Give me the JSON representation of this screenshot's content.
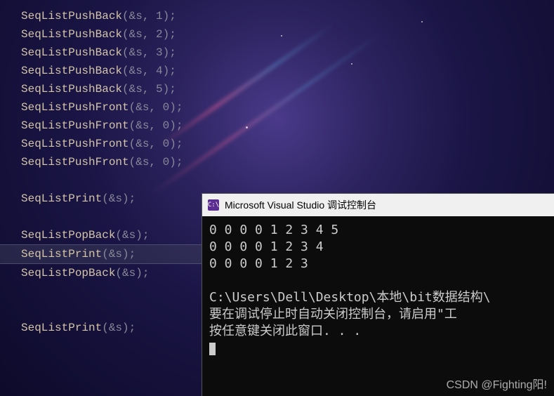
{
  "code": {
    "lines": [
      {
        "fn": "SeqListPushBack",
        "args": "(&s, 1)"
      },
      {
        "fn": "SeqListPushBack",
        "args": "(&s, 2)"
      },
      {
        "fn": "SeqListPushBack",
        "args": "(&s, 3)"
      },
      {
        "fn": "SeqListPushBack",
        "args": "(&s, 4)"
      },
      {
        "fn": "SeqListPushBack",
        "args": "(&s, 5)"
      },
      {
        "fn": "SeqListPushFront",
        "args": "(&s, 0)"
      },
      {
        "fn": "SeqListPushFront",
        "args": "(&s, 0)"
      },
      {
        "fn": "SeqListPushFront",
        "args": "(&s, 0)"
      },
      {
        "fn": "SeqListPushFront",
        "args": "(&s, 0)"
      }
    ],
    "print1": {
      "fn": "SeqListPrint",
      "args": "(&s)"
    },
    "pop1": {
      "fn": "SeqListPopBack",
      "args": "(&s)"
    },
    "print2_hl": {
      "fn": "SeqListPrint",
      "args": "(&s)"
    },
    "pop2": {
      "fn": "SeqListPopBack",
      "args": "(&s)"
    },
    "print3": {
      "fn": "SeqListPrint",
      "args": "(&s)"
    }
  },
  "console": {
    "icon_text": "C:\\",
    "title": "Microsoft Visual Studio 调试控制台",
    "output_line1": "0 0 0 0 1 2 3 4 5",
    "output_line2": "0 0 0 0 1 2 3 4",
    "output_line3": "0 0 0 0 1 2 3",
    "path_line": "C:\\Users\\Dell\\Desktop\\本地\\bit数据结构\\",
    "hint_line1": "要在调试停止时自动关闭控制台，请启用\"工",
    "hint_line2": "按任意键关闭此窗口. . ."
  },
  "watermark": "CSDN @Fighting阳!"
}
